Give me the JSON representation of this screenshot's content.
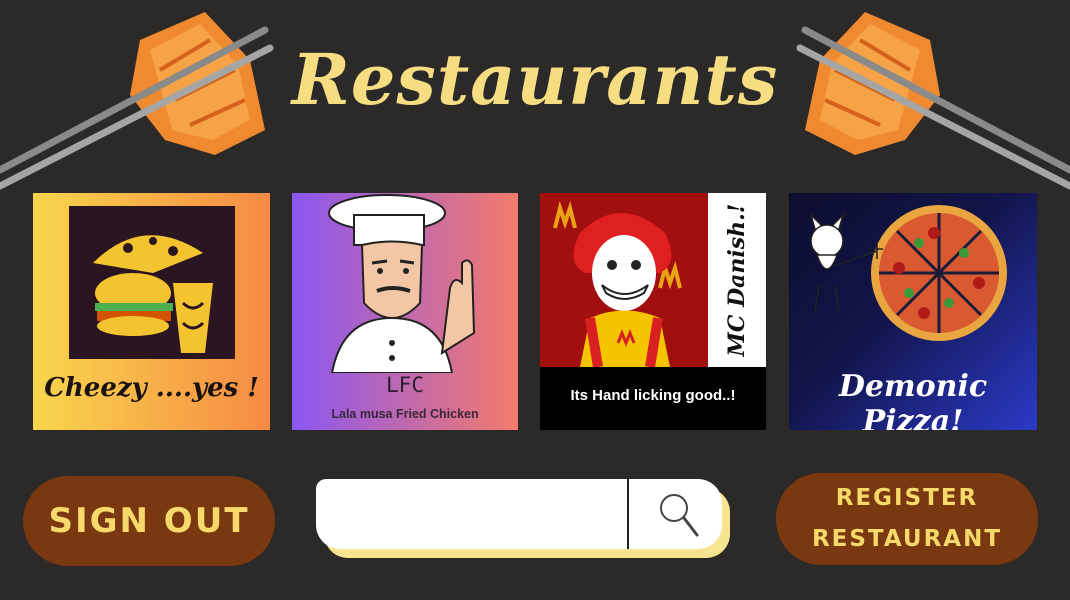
{
  "header": {
    "title": "Restaurants"
  },
  "restaurants": [
    {
      "name": "Cheezy ....yes !"
    },
    {
      "name": "LFC",
      "subtitle": "Lala musa Fried Chicken"
    },
    {
      "name": "MC Danish.!",
      "tagline": "Its Hand licking good..!"
    },
    {
      "name": "Demonic Pizza!"
    }
  ],
  "actions": {
    "sign_out": "SIGN OUT",
    "register_line1": "REGISTER",
    "register_line2": "RESTAURANT"
  },
  "search": {
    "value": "",
    "placeholder": ""
  },
  "icons": [
    "chopsticks-icon",
    "search-icon"
  ],
  "colors": {
    "background": "#2b2a29",
    "title": "#f6dd82",
    "pill_bg": "#7a3810",
    "pill_text": "#f6d96a",
    "search_shadow": "#f6e48e"
  }
}
